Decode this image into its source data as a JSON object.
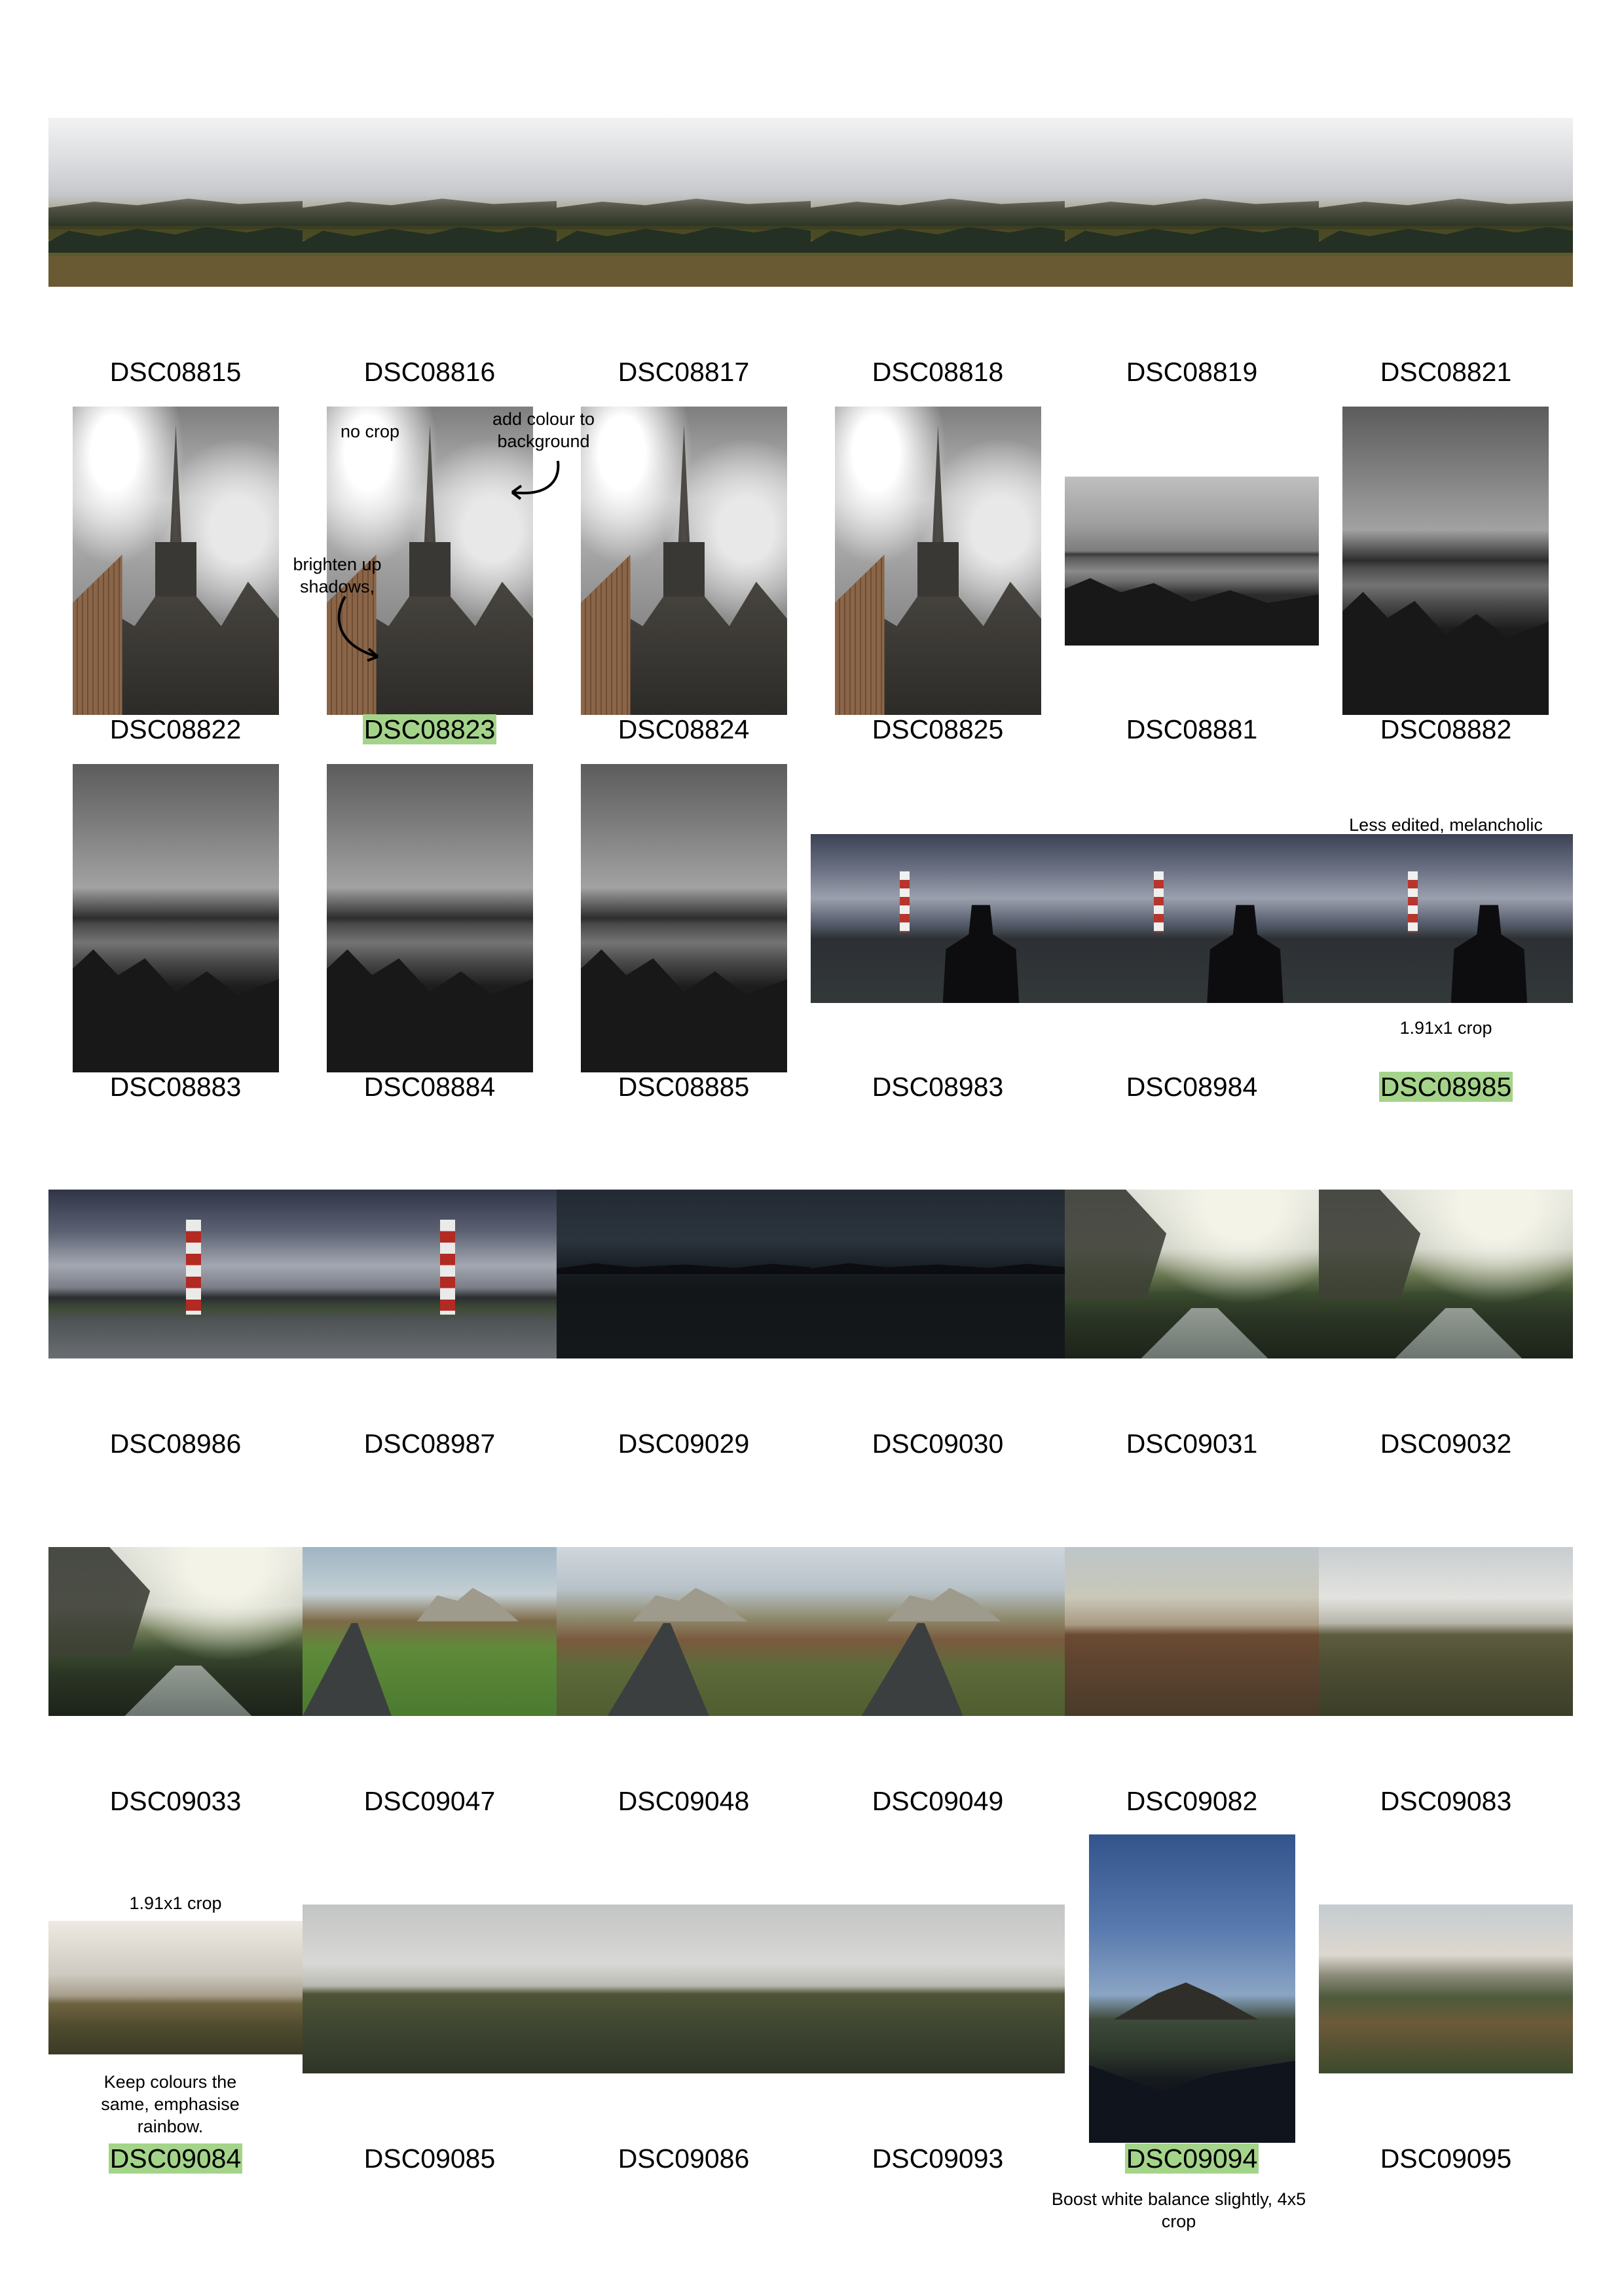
{
  "rows": [
    {
      "items": [
        {
          "label": "DSC08815",
          "highlight": false
        },
        {
          "label": "DSC08816",
          "highlight": false
        },
        {
          "label": "DSC08817",
          "highlight": false
        },
        {
          "label": "DSC08818",
          "highlight": false
        },
        {
          "label": "DSC08819",
          "highlight": false
        },
        {
          "label": "DSC08821",
          "highlight": false
        }
      ]
    },
    {
      "items": [
        {
          "label": "DSC08822",
          "highlight": false
        },
        {
          "label": "DSC08823",
          "highlight": true
        },
        {
          "label": "DSC08824",
          "highlight": false
        },
        {
          "label": "DSC08825",
          "highlight": false
        },
        {
          "label": "DSC08881",
          "highlight": false
        },
        {
          "label": "DSC08882",
          "highlight": false
        }
      ]
    },
    {
      "items": [
        {
          "label": "DSC08883",
          "highlight": false
        },
        {
          "label": "DSC08884",
          "highlight": false
        },
        {
          "label": "DSC08885",
          "highlight": false
        },
        {
          "label": "DSC08983",
          "highlight": false
        },
        {
          "label": "DSC08984",
          "highlight": false
        },
        {
          "label": "DSC08985",
          "highlight": true
        }
      ]
    },
    {
      "items": [
        {
          "label": "DSC08986",
          "highlight": false
        },
        {
          "label": "DSC08987",
          "highlight": false
        },
        {
          "label": "DSC09029",
          "highlight": false
        },
        {
          "label": "DSC09030",
          "highlight": false
        },
        {
          "label": "DSC09031",
          "highlight": false
        },
        {
          "label": "DSC09032",
          "highlight": false
        }
      ]
    },
    {
      "items": [
        {
          "label": "DSC09033",
          "highlight": false
        },
        {
          "label": "DSC09047",
          "highlight": false
        },
        {
          "label": "DSC09048",
          "highlight": false
        },
        {
          "label": "DSC09049",
          "highlight": false
        },
        {
          "label": "DSC09082",
          "highlight": false
        },
        {
          "label": "DSC09083",
          "highlight": false
        }
      ]
    },
    {
      "items": [
        {
          "label": "DSC09084",
          "highlight": true
        },
        {
          "label": "DSC09085",
          "highlight": false
        },
        {
          "label": "DSC09086",
          "highlight": false
        },
        {
          "label": "DSC09093",
          "highlight": false
        },
        {
          "label": "DSC09094",
          "highlight": true
        },
        {
          "label": "DSC09095",
          "highlight": false
        }
      ]
    }
  ],
  "notes": {
    "no_crop": "no crop",
    "add_colour": "add colour to background",
    "brighten": "brighten up shadows,",
    "less_edited": "Less edited, melancholic",
    "crop_08985": "1.91x1 crop",
    "crop_09084": "1.91x1 crop",
    "keep_colours": "Keep colours the same, emphasise rainbow.",
    "boost_wb": "Boost white balance slightly, 4x5 crop"
  },
  "highlight_color": "#a4d48a"
}
